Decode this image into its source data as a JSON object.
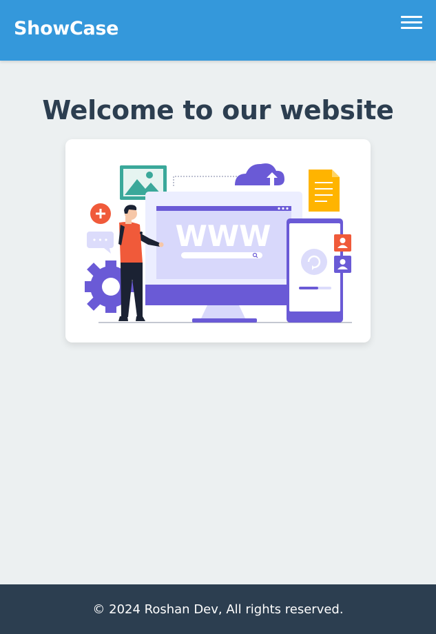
{
  "navbar": {
    "brand": "ShowCase",
    "menu_icon": "hamburger-menu-icon"
  },
  "hero": {
    "title": "Welcome to our website",
    "illustration": {
      "screen_text": "WWW",
      "icons": [
        "image-icon",
        "cloud-upload-icon",
        "document-icon",
        "plus-icon",
        "chat-icon",
        "gear-icon",
        "refresh-icon",
        "user-icon",
        "search-icon"
      ]
    }
  },
  "footer": {
    "text": "© 2024 Roshan Dev, All rights reserved."
  },
  "colors": {
    "navbar": "#3498db",
    "background": "#ecf0f1",
    "heading": "#2c3e50",
    "footer": "#2c3e50",
    "accent_purple": "#6a5ad6",
    "accent_orange": "#f05a3a",
    "accent_teal": "#3aa89a",
    "accent_yellow": "#ffb400"
  }
}
